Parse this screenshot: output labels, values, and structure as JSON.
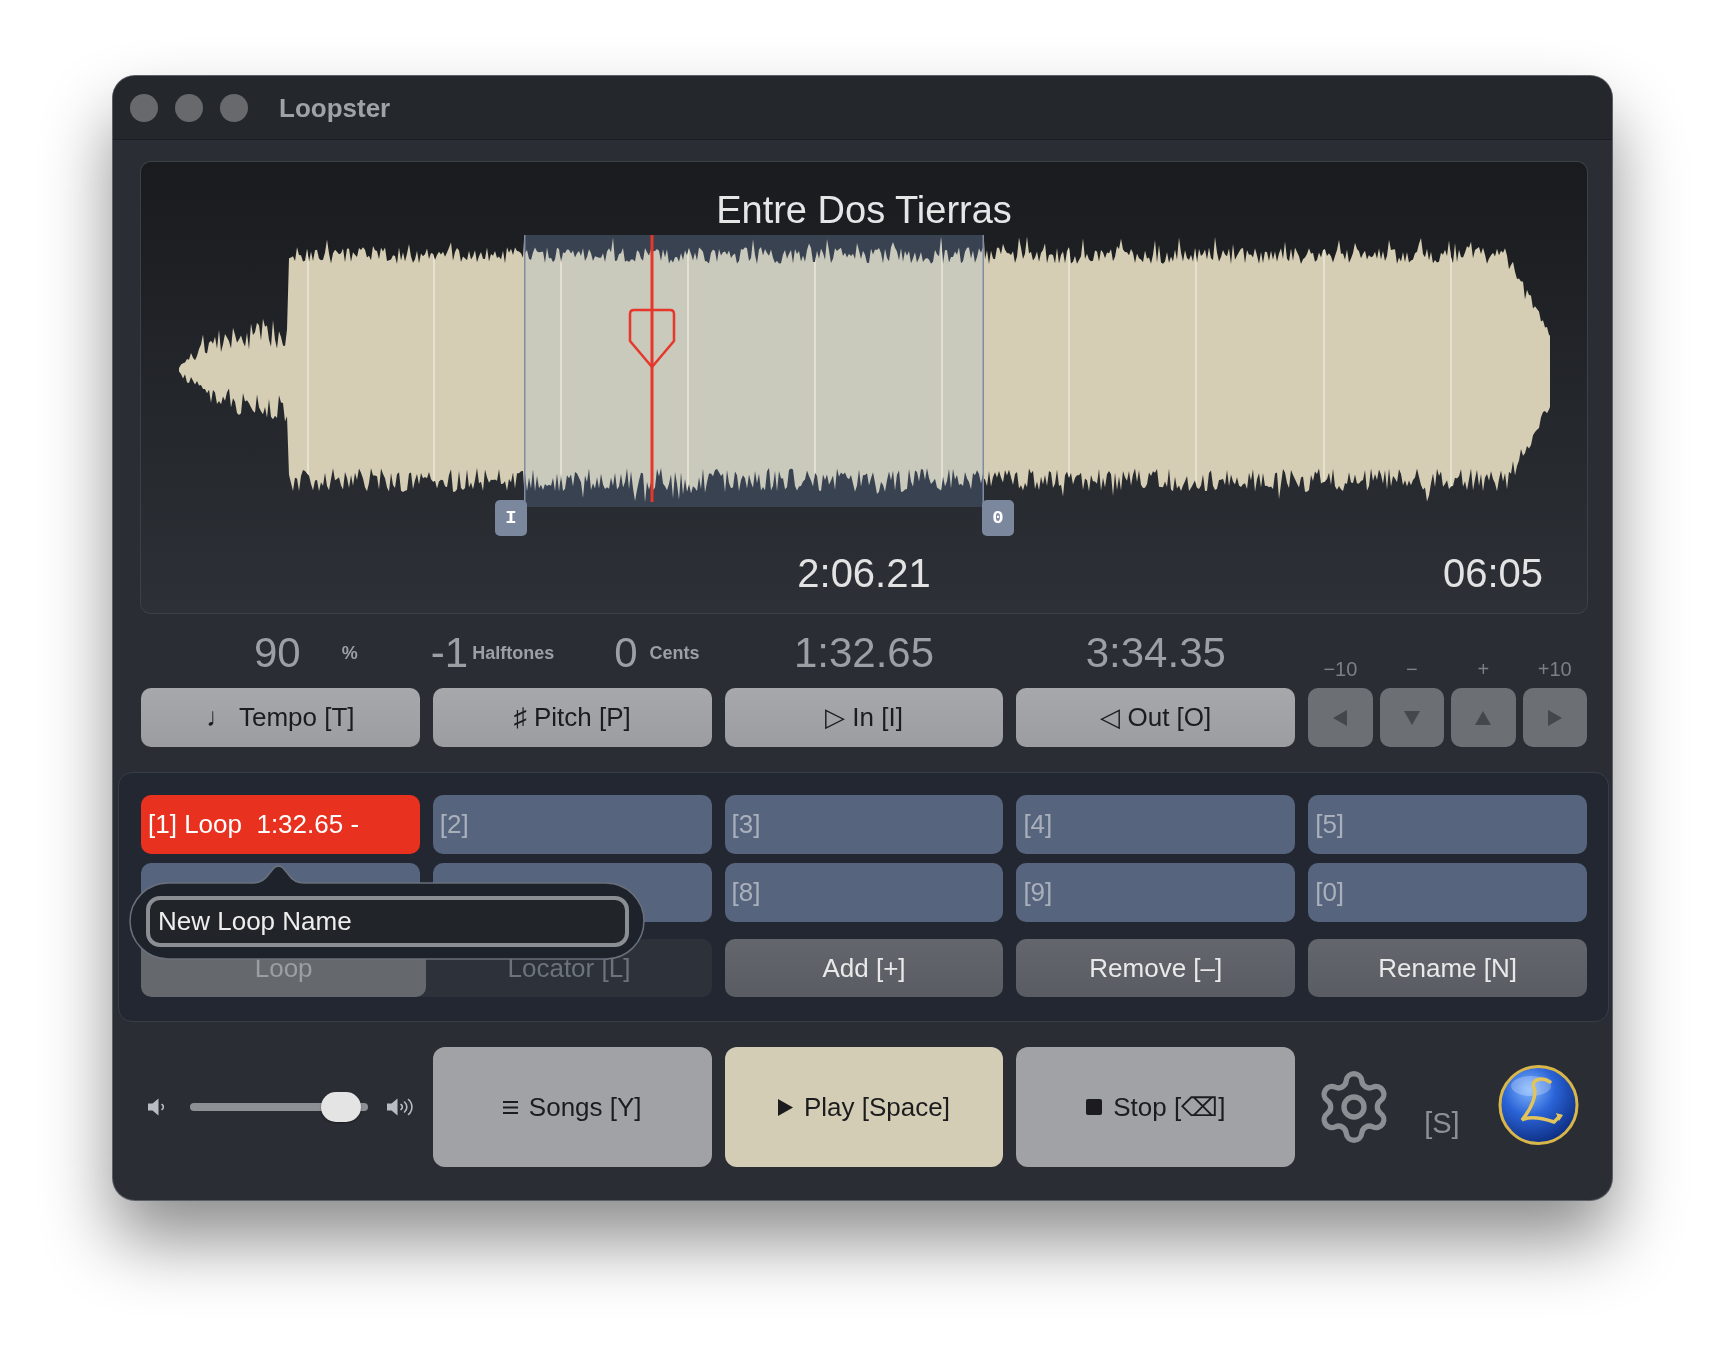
{
  "window": {
    "title": "Loopster"
  },
  "waveform": {
    "song_title": "Entre Dos Tierras",
    "in_marker": "I",
    "out_marker": "0",
    "position": "2:06.21",
    "duration": "06:05"
  },
  "readouts": [
    {
      "value": "90",
      "unit": "%"
    },
    {
      "value": "-1",
      "unit": "Halftones"
    },
    {
      "value": "0",
      "unit": "Cents"
    },
    {
      "value": "1:32.65"
    },
    {
      "value": "3:34.35"
    }
  ],
  "controls": [
    {
      "label": "♩ Tempo [T]"
    },
    {
      "label": "♯ Pitch [P]"
    },
    {
      "label": "▷ In [I]"
    },
    {
      "label": "◁ Out [O]"
    }
  ],
  "nudge": [
    {
      "caption": "−10",
      "kind": "left"
    },
    {
      "caption": "−",
      "kind": "down"
    },
    {
      "caption": "+",
      "kind": "up"
    },
    {
      "caption": "+10",
      "kind": "right"
    }
  ],
  "loop_slots": [
    {
      "label": "[1] Loop  1:32.65 -",
      "selected": true
    },
    {
      "label": "[2]",
      "selected": false
    },
    {
      "label": "[3]",
      "selected": false
    },
    {
      "label": "[4]",
      "selected": false
    },
    {
      "label": "[5]",
      "selected": false
    },
    {
      "selected": false
    },
    {
      "selected": false
    },
    {
      "label": "[8]",
      "selected": false
    },
    {
      "label": "[9]",
      "selected": false
    },
    {
      "label": "[0]",
      "selected": false
    }
  ],
  "modes": [
    {
      "label": "Loop",
      "selected": true
    },
    {
      "label": "Locator [L]",
      "selected": false
    }
  ],
  "actions": [
    "Add [+]",
    "Remove [–]",
    "Rename [N]"
  ],
  "rename_popover": {
    "value": "New Loop Name"
  },
  "volume": {
    "level": 0.95
  },
  "transport": [
    {
      "kind": "songs",
      "label": "Songs [Y]",
      "active": false
    },
    {
      "kind": "play",
      "label": "Play [Space]",
      "active": true
    },
    {
      "kind": "stop",
      "label": "Stop [⌫]",
      "active": false
    }
  ],
  "settings": {
    "shortcut": "[S]"
  }
}
